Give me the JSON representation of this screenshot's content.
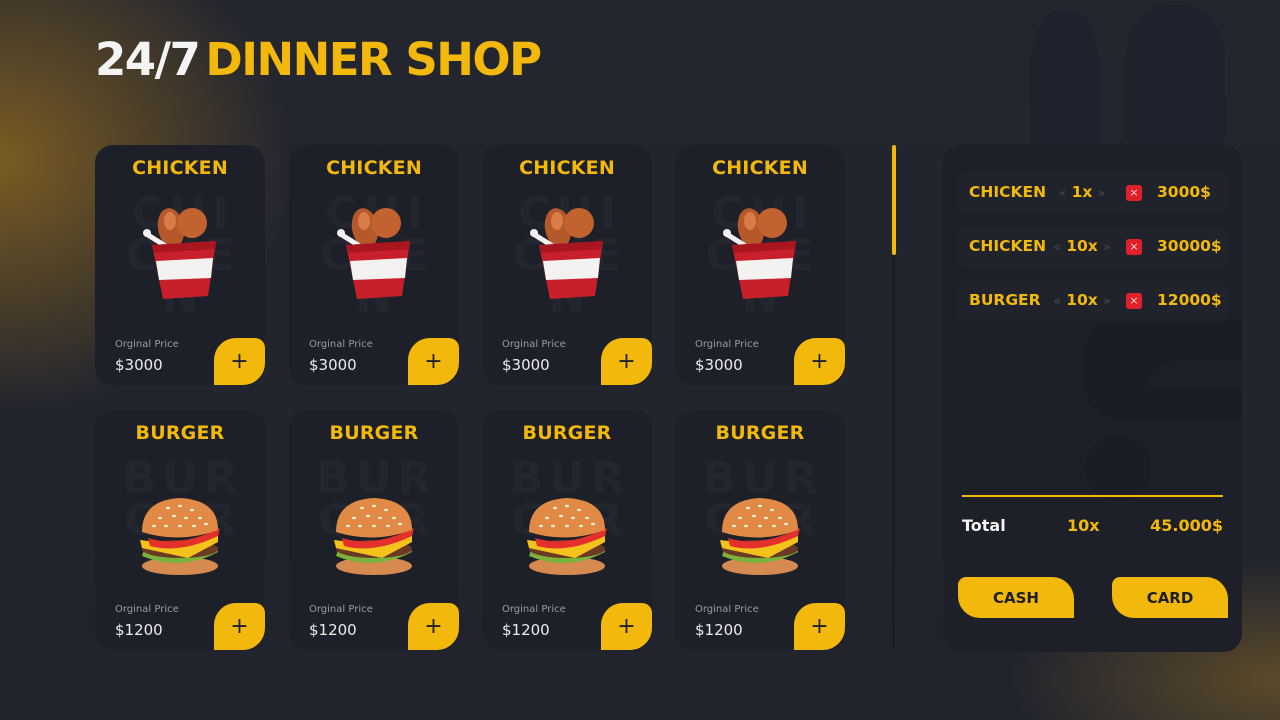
{
  "header": {
    "title_prefix": "24/7",
    "title_main": "DINNER SHOP"
  },
  "products": [
    {
      "name": "CHICKEN",
      "watermark": "CHICKEN",
      "icon": "chicken-bucket",
      "price_label": "Orginal Price",
      "price": "$3000",
      "add_label": "+"
    },
    {
      "name": "CHICKEN",
      "watermark": "CHICKEN",
      "icon": "chicken-bucket",
      "price_label": "Orginal Price",
      "price": "$3000",
      "add_label": "+"
    },
    {
      "name": "CHICKEN",
      "watermark": "CHICKEN",
      "icon": "chicken-bucket",
      "price_label": "Orginal Price",
      "price": "$3000",
      "add_label": "+"
    },
    {
      "name": "CHICKEN",
      "watermark": "CHICKEN",
      "icon": "chicken-bucket",
      "price_label": "Orginal Price",
      "price": "$3000",
      "add_label": "+"
    },
    {
      "name": "BURGER",
      "watermark": "BURGER",
      "icon": "burger",
      "price_label": "Orginal Price",
      "price": "$1200",
      "add_label": "+"
    },
    {
      "name": "BURGER",
      "watermark": "BURGER",
      "icon": "burger",
      "price_label": "Orginal Price",
      "price": "$1200",
      "add_label": "+"
    },
    {
      "name": "BURGER",
      "watermark": "BURGER",
      "icon": "burger",
      "price_label": "Orginal Price",
      "price": "$1200",
      "add_label": "+"
    },
    {
      "name": "BURGER",
      "watermark": "BURGER",
      "icon": "burger",
      "price_label": "Orginal Price",
      "price": "$1200",
      "add_label": "+"
    }
  ],
  "cart": {
    "items": [
      {
        "name": "CHICKEN",
        "qty": "1x",
        "dec": "«",
        "inc": "»",
        "remove": "×",
        "price": "3000$"
      },
      {
        "name": "CHICKEN",
        "qty": "10x",
        "dec": "«",
        "inc": "»",
        "remove": "×",
        "price": "30000$"
      },
      {
        "name": "BURGER",
        "qty": "10x",
        "dec": "«",
        "inc": "»",
        "remove": "×",
        "price": "12000$"
      }
    ],
    "total_label": "Total",
    "total_qty": "10x",
    "total_amount": "45.000$",
    "cash_label": "CASH",
    "card_label": "CARD"
  },
  "scroll": {
    "position": 0
  },
  "colors": {
    "accent": "#f2b90c",
    "card_bg": "#1e2029",
    "remove": "#e0212b"
  }
}
